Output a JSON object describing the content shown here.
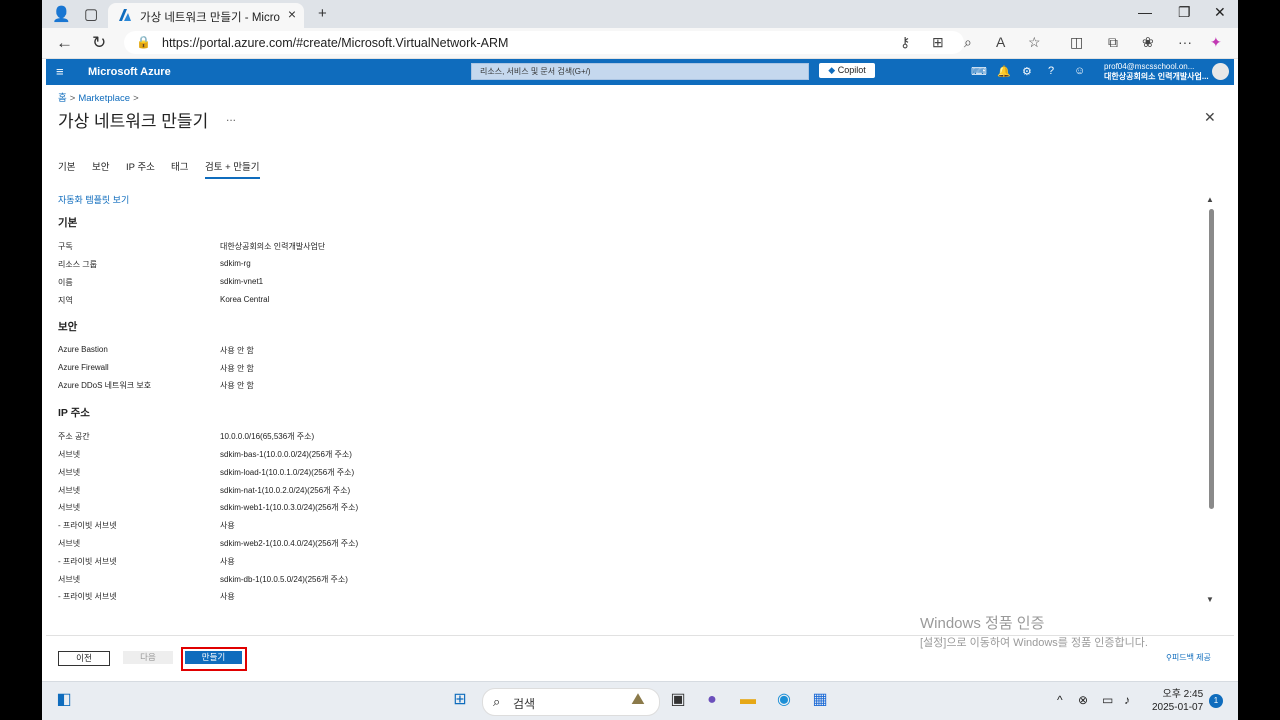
{
  "browser": {
    "tab_title": "가상 네트워크 만들기 - Microsoft",
    "url": "https://portal.azure.com/#create/Microsoft.VirtualNetwork-ARM"
  },
  "azure": {
    "brand": "Microsoft Azure",
    "search_placeholder": "리소스, 서비스 및 문서 검색(G+/)",
    "copilot_label": "Copilot",
    "user_email": "prof04@mscsschool.on...",
    "user_org": "대한상공회의소 인력개발사업..."
  },
  "page": {
    "breadcrumb_home": "홈",
    "breadcrumb_marketplace": "Marketplace",
    "breadcrumb_sep": ">",
    "title": "가상 네트워크 만들기",
    "more": "...",
    "tabs": [
      "기본",
      "보안",
      "IP 주소",
      "태그",
      "검토 + 만들기"
    ],
    "automation_link": "자동화 템플릿 보기"
  },
  "review": {
    "basic_title": "기본",
    "basic": [
      {
        "k": "구독",
        "v": "대한상공회의소 인력개발사업단"
      },
      {
        "k": "리소스 그룹",
        "v": "sdkim-rg"
      },
      {
        "k": "이름",
        "v": "sdkim-vnet1"
      },
      {
        "k": "지역",
        "v": "Korea Central"
      }
    ],
    "security_title": "보안",
    "security": [
      {
        "k": "Azure Bastion",
        "v": "사용 안 함"
      },
      {
        "k": "Azure Firewall",
        "v": "사용 안 함"
      },
      {
        "k": "Azure DDoS 네트워크 보호",
        "v": "사용 안 함"
      }
    ],
    "ip_title": "IP 주소",
    "ip": [
      {
        "k": "주소 공간",
        "v": "10.0.0.0/16(65,536개 주소)"
      },
      {
        "k": "서브넷",
        "v": "sdkim-bas-1(10.0.0.0/24)(256개 주소)"
      },
      {
        "k": "서브넷",
        "v": "sdkim-load-1(10.0.1.0/24)(256개 주소)"
      },
      {
        "k": "서브넷",
        "v": "sdkim-nat-1(10.0.2.0/24)(256개 주소)"
      },
      {
        "k": "서브넷",
        "v": "sdkim-web1-1(10.0.3.0/24)(256개 주소)"
      },
      {
        "k": "- 프라이빗 서브넷",
        "v": "사용"
      },
      {
        "k": "서브넷",
        "v": "sdkim-web2-1(10.0.4.0/24)(256개 주소)"
      },
      {
        "k": "- 프라이빗 서브넷",
        "v": "사용"
      },
      {
        "k": "서브넷",
        "v": "sdkim-db-1(10.0.5.0/24)(256개 주소)"
      },
      {
        "k": "- 프라이빗 서브넷",
        "v": "사용"
      }
    ]
  },
  "footer": {
    "prev": "이전",
    "next": "다음",
    "create": "만들기",
    "feedback": "피드백 제공"
  },
  "watermark": {
    "line1": "Windows 정품 인증",
    "line2": "[설정]으로 이동하여 Windows를 정품 인증합니다."
  },
  "taskbar": {
    "search": "검색",
    "time": "오후 2:45",
    "date": "2025-01-07",
    "notifications": "1"
  },
  "colors": {
    "azure_blue": "#0f6cbd",
    "highlight_red": "#e00000"
  }
}
